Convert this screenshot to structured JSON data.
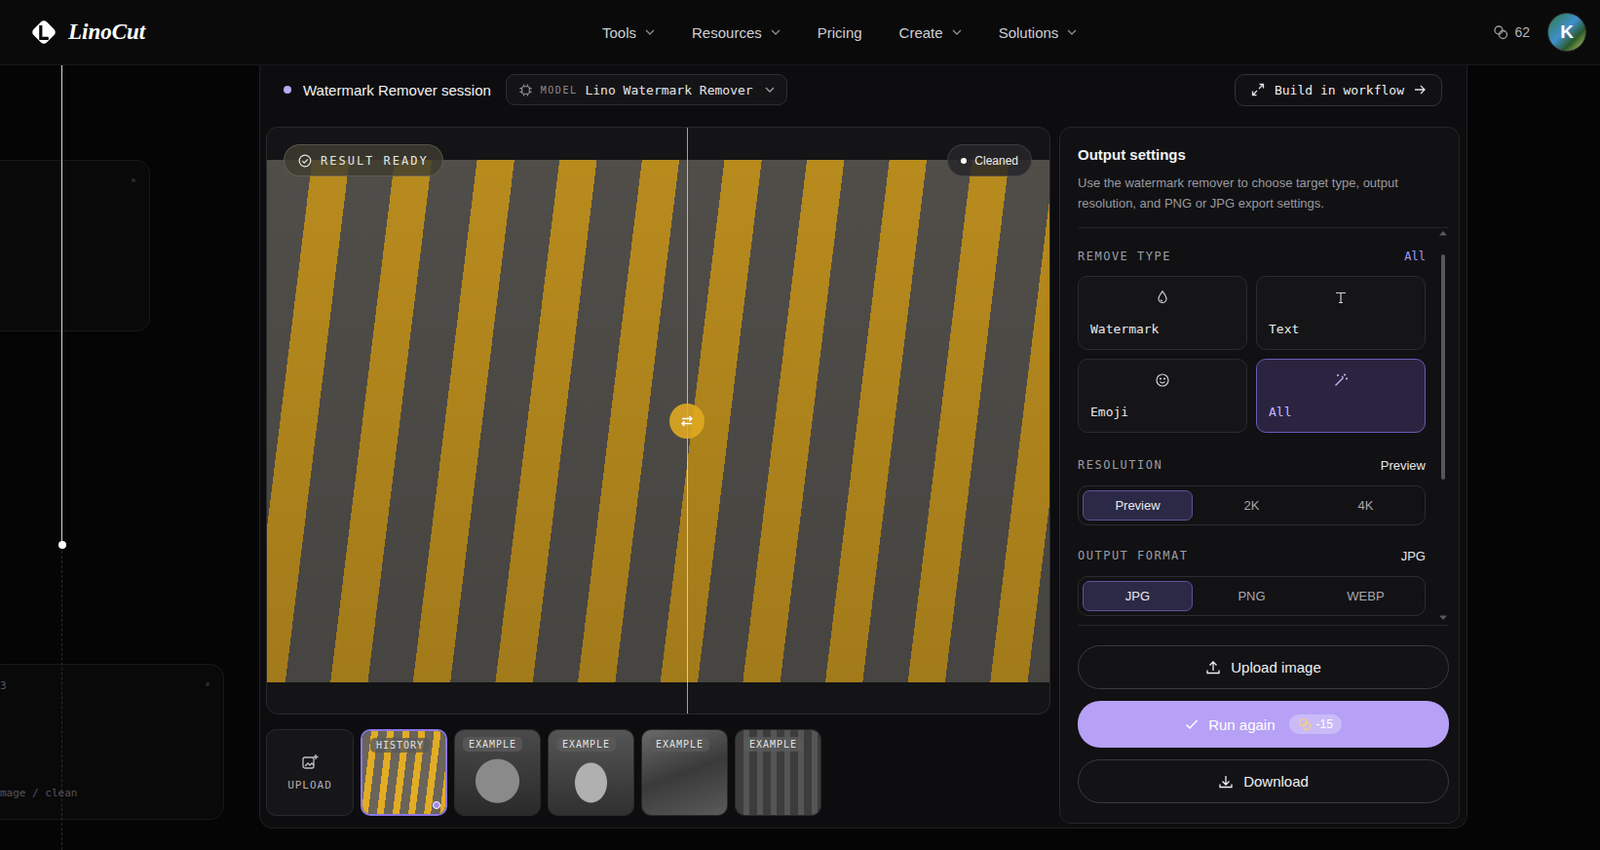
{
  "app": {
    "logo": "LinoCut"
  },
  "nav": [
    {
      "label": "Tools",
      "kind": "menu"
    },
    {
      "label": "Resources",
      "kind": "menu"
    },
    {
      "label": "Pricing",
      "kind": "link"
    },
    {
      "label": "Create",
      "kind": "menu"
    },
    {
      "label": "Solutions",
      "kind": "menu"
    }
  ],
  "account": {
    "credits": "62",
    "avatar": "K"
  },
  "backdrop": {
    "number": "3",
    "caption": "mage / clean"
  },
  "session": {
    "title": "Watermark Remover session",
    "model_label": "MODEL",
    "model": "Lino Watermark Remover",
    "workflow_button": "Build in workflow"
  },
  "preview": {
    "status": "RESULT READY",
    "badge": "Cleaned",
    "compare": {
      "level": 0.537
    }
  },
  "thumbnails": [
    {
      "kind": "upload",
      "label": "UPLOAD",
      "selected": false
    },
    {
      "kind": "history",
      "label": "HISTORY",
      "selected": true
    },
    {
      "kind": "example",
      "label": "EXAMPLE",
      "selected": false
    },
    {
      "kind": "example",
      "label": "EXAMPLE",
      "selected": false
    },
    {
      "kind": "example",
      "label": "EXAMPLE",
      "selected": false
    },
    {
      "kind": "example",
      "label": "EXAMPLE",
      "selected": false
    }
  ],
  "settings": {
    "title": "Output settings",
    "description": "Use the watermark remover to choose target type, output resolution, and PNG or JPG export settings.",
    "remove_type": {
      "label": "REMOVE TYPE",
      "value": "All",
      "options": [
        {
          "label": "Watermark",
          "selected": false
        },
        {
          "label": "Text",
          "selected": false
        },
        {
          "label": "Emoji",
          "selected": false
        },
        {
          "label": "All",
          "selected": true
        }
      ]
    },
    "resolution": {
      "label": "RESOLUTION",
      "value": "Preview",
      "options": [
        {
          "label": "Preview",
          "selected": true
        },
        {
          "label": "2K",
          "selected": false
        },
        {
          "label": "4K",
          "selected": false
        }
      ]
    },
    "output_format": {
      "label": "OUTPUT FORMAT",
      "value": "JPG",
      "options": [
        {
          "label": "JPG",
          "selected": true
        },
        {
          "label": "PNG",
          "selected": false
        },
        {
          "label": "WEBP",
          "selected": false
        }
      ]
    },
    "scrollbar": {
      "level": 0.62
    }
  },
  "actions": {
    "upload": "Upload image",
    "run": "Run again",
    "run_cost": "-15",
    "download": "Download"
  }
}
